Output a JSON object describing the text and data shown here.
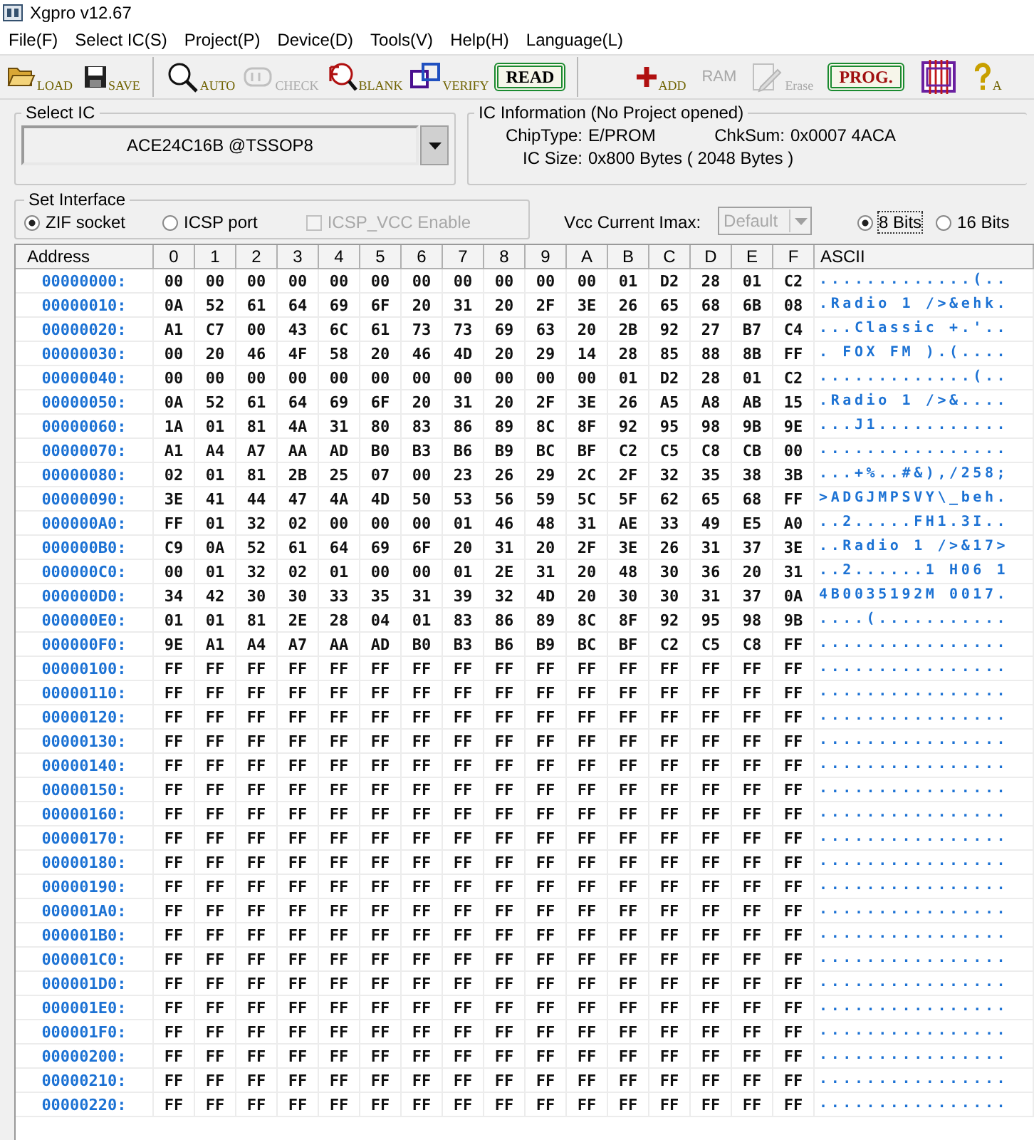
{
  "window": {
    "title": "Xgpro v12.67"
  },
  "menu": [
    "File(F)",
    "Select IC(S)",
    "Project(P)",
    "Device(D)",
    "Tools(V)",
    "Help(H)",
    "Language(L)"
  ],
  "toolbar": {
    "groups": [
      {
        "buttons": [
          {
            "label": "LOAD",
            "kind": "plain",
            "disabled": false
          },
          {
            "label": "SAVE",
            "kind": "plain",
            "disabled": false
          }
        ]
      },
      {
        "buttons": [
          {
            "label": "AUTO",
            "kind": "plain",
            "disabled": false
          },
          {
            "label": "CHECK",
            "kind": "plain",
            "disabled": true
          },
          {
            "label": "BLANK",
            "kind": "plain",
            "disabled": false
          },
          {
            "label": "VERIFY",
            "kind": "plain",
            "disabled": false
          },
          {
            "label": "READ",
            "kind": "boxed",
            "disabled": false
          }
        ]
      },
      {
        "buttons": [
          {
            "label": "ADD",
            "kind": "plain",
            "disabled": false
          },
          {
            "label": "RAM",
            "kind": "text",
            "disabled": true
          },
          {
            "label": "Erase",
            "kind": "plain",
            "disabled": true
          },
          {
            "label": "PROG.",
            "kind": "boxed",
            "disabled": false
          },
          {
            "kind": "icon",
            "disabled": false
          },
          {
            "label": "A",
            "kind": "plain",
            "disabled": false
          }
        ]
      }
    ]
  },
  "select_ic": {
    "title": "Select IC",
    "value": "ACE24C16B @TSSOP8"
  },
  "ic_info": {
    "title": "IC Information (No Project opened)",
    "chip_type": {
      "label": "ChipType:",
      "value": "E/PROM"
    },
    "checksum": {
      "label": "ChkSum:",
      "value": "0x0007 4ACA"
    },
    "ic_size": {
      "label": "IC Size:",
      "value": "0x800 Bytes ( 2048 Bytes )"
    }
  },
  "interface": {
    "title": "Set Interface",
    "options": [
      {
        "label": "ZIF socket",
        "selected": true
      },
      {
        "label": "ICSP port",
        "selected": false
      }
    ],
    "icsp_vcc": {
      "label": "ICSP_VCC Enable",
      "checked": false,
      "disabled": true
    }
  },
  "vcc": {
    "label": "Vcc Current Imax:",
    "value": "Default",
    "disabled": true
  },
  "bits": [
    {
      "label": "8 Bits",
      "selected": true
    },
    {
      "label": "16 Bits",
      "selected": false
    }
  ],
  "table": {
    "columns": [
      "Address",
      "0",
      "1",
      "2",
      "3",
      "4",
      "5",
      "6",
      "7",
      "8",
      "9",
      "A",
      "B",
      "C",
      "D",
      "E",
      "F",
      "ASCII"
    ],
    "rows": [
      {
        "address": "00000000:",
        "bytes": [
          "00",
          "00",
          "00",
          "00",
          "00",
          "00",
          "00",
          "00",
          "00",
          "00",
          "00",
          "01",
          "D2",
          "28",
          "01",
          "C2"
        ],
        "ascii": ".............(.."
      },
      {
        "address": "00000010:",
        "bytes": [
          "0A",
          "52",
          "61",
          "64",
          "69",
          "6F",
          "20",
          "31",
          "20",
          "2F",
          "3E",
          "26",
          "65",
          "68",
          "6B",
          "08"
        ],
        "ascii": ".Radio 1 />&ehk."
      },
      {
        "address": "00000020:",
        "bytes": [
          "A1",
          "C7",
          "00",
          "43",
          "6C",
          "61",
          "73",
          "73",
          "69",
          "63",
          "20",
          "2B",
          "92",
          "27",
          "B7",
          "C4"
        ],
        "ascii": "...Classic +.'.."
      },
      {
        "address": "00000030:",
        "bytes": [
          "00",
          "20",
          "46",
          "4F",
          "58",
          "20",
          "46",
          "4D",
          "20",
          "29",
          "14",
          "28",
          "85",
          "88",
          "8B",
          "FF"
        ],
        "ascii": ". FOX FM ).(...."
      },
      {
        "address": "00000040:",
        "bytes": [
          "00",
          "00",
          "00",
          "00",
          "00",
          "00",
          "00",
          "00",
          "00",
          "00",
          "00",
          "01",
          "D2",
          "28",
          "01",
          "C2"
        ],
        "ascii": ".............(.."
      },
      {
        "address": "00000050:",
        "bytes": [
          "0A",
          "52",
          "61",
          "64",
          "69",
          "6F",
          "20",
          "31",
          "20",
          "2F",
          "3E",
          "26",
          "A5",
          "A8",
          "AB",
          "15"
        ],
        "ascii": ".Radio 1 />&...."
      },
      {
        "address": "00000060:",
        "bytes": [
          "1A",
          "01",
          "81",
          "4A",
          "31",
          "80",
          "83",
          "86",
          "89",
          "8C",
          "8F",
          "92",
          "95",
          "98",
          "9B",
          "9E"
        ],
        "ascii": "...J1..........."
      },
      {
        "address": "00000070:",
        "bytes": [
          "A1",
          "A4",
          "A7",
          "AA",
          "AD",
          "B0",
          "B3",
          "B6",
          "B9",
          "BC",
          "BF",
          "C2",
          "C5",
          "C8",
          "CB",
          "00"
        ],
        "ascii": "................"
      },
      {
        "address": "00000080:",
        "bytes": [
          "02",
          "01",
          "81",
          "2B",
          "25",
          "07",
          "00",
          "23",
          "26",
          "29",
          "2C",
          "2F",
          "32",
          "35",
          "38",
          "3B"
        ],
        "ascii": "...+%..#&),/258;"
      },
      {
        "address": "00000090:",
        "bytes": [
          "3E",
          "41",
          "44",
          "47",
          "4A",
          "4D",
          "50",
          "53",
          "56",
          "59",
          "5C",
          "5F",
          "62",
          "65",
          "68",
          "FF"
        ],
        "ascii": ">ADGJMPSVY\\_beh."
      },
      {
        "address": "000000A0:",
        "bytes": [
          "FF",
          "01",
          "32",
          "02",
          "00",
          "00",
          "00",
          "01",
          "46",
          "48",
          "31",
          "AE",
          "33",
          "49",
          "E5",
          "A0"
        ],
        "ascii": "..2.....FH1.3I.."
      },
      {
        "address": "000000B0:",
        "bytes": [
          "C9",
          "0A",
          "52",
          "61",
          "64",
          "69",
          "6F",
          "20",
          "31",
          "20",
          "2F",
          "3E",
          "26",
          "31",
          "37",
          "3E"
        ],
        "ascii": "..Radio 1 />&17>"
      },
      {
        "address": "000000C0:",
        "bytes": [
          "00",
          "01",
          "32",
          "02",
          "01",
          "00",
          "00",
          "01",
          "2E",
          "31",
          "20",
          "48",
          "30",
          "36",
          "20",
          "31"
        ],
        "ascii": "..2......1 H06 1"
      },
      {
        "address": "000000D0:",
        "bytes": [
          "34",
          "42",
          "30",
          "30",
          "33",
          "35",
          "31",
          "39",
          "32",
          "4D",
          "20",
          "30",
          "30",
          "31",
          "37",
          "0A"
        ],
        "ascii": "4B0035192M 0017."
      },
      {
        "address": "000000E0:",
        "bytes": [
          "01",
          "01",
          "81",
          "2E",
          "28",
          "04",
          "01",
          "83",
          "86",
          "89",
          "8C",
          "8F",
          "92",
          "95",
          "98",
          "9B"
        ],
        "ascii": "....(..........."
      },
      {
        "address": "000000F0:",
        "bytes": [
          "9E",
          "A1",
          "A4",
          "A7",
          "AA",
          "AD",
          "B0",
          "B3",
          "B6",
          "B9",
          "BC",
          "BF",
          "C2",
          "C5",
          "C8",
          "FF"
        ],
        "ascii": "................"
      },
      {
        "address": "00000100:",
        "bytes": [
          "FF",
          "FF",
          "FF",
          "FF",
          "FF",
          "FF",
          "FF",
          "FF",
          "FF",
          "FF",
          "FF",
          "FF",
          "FF",
          "FF",
          "FF",
          "FF"
        ],
        "ascii": "................"
      },
      {
        "address": "00000110:",
        "bytes": [
          "FF",
          "FF",
          "FF",
          "FF",
          "FF",
          "FF",
          "FF",
          "FF",
          "FF",
          "FF",
          "FF",
          "FF",
          "FF",
          "FF",
          "FF",
          "FF"
        ],
        "ascii": "................"
      },
      {
        "address": "00000120:",
        "bytes": [
          "FF",
          "FF",
          "FF",
          "FF",
          "FF",
          "FF",
          "FF",
          "FF",
          "FF",
          "FF",
          "FF",
          "FF",
          "FF",
          "FF",
          "FF",
          "FF"
        ],
        "ascii": "................"
      },
      {
        "address": "00000130:",
        "bytes": [
          "FF",
          "FF",
          "FF",
          "FF",
          "FF",
          "FF",
          "FF",
          "FF",
          "FF",
          "FF",
          "FF",
          "FF",
          "FF",
          "FF",
          "FF",
          "FF"
        ],
        "ascii": "................"
      },
      {
        "address": "00000140:",
        "bytes": [
          "FF",
          "FF",
          "FF",
          "FF",
          "FF",
          "FF",
          "FF",
          "FF",
          "FF",
          "FF",
          "FF",
          "FF",
          "FF",
          "FF",
          "FF",
          "FF"
        ],
        "ascii": "................"
      },
      {
        "address": "00000150:",
        "bytes": [
          "FF",
          "FF",
          "FF",
          "FF",
          "FF",
          "FF",
          "FF",
          "FF",
          "FF",
          "FF",
          "FF",
          "FF",
          "FF",
          "FF",
          "FF",
          "FF"
        ],
        "ascii": "................"
      },
      {
        "address": "00000160:",
        "bytes": [
          "FF",
          "FF",
          "FF",
          "FF",
          "FF",
          "FF",
          "FF",
          "FF",
          "FF",
          "FF",
          "FF",
          "FF",
          "FF",
          "FF",
          "FF",
          "FF"
        ],
        "ascii": "................"
      },
      {
        "address": "00000170:",
        "bytes": [
          "FF",
          "FF",
          "FF",
          "FF",
          "FF",
          "FF",
          "FF",
          "FF",
          "FF",
          "FF",
          "FF",
          "FF",
          "FF",
          "FF",
          "FF",
          "FF"
        ],
        "ascii": "................"
      },
      {
        "address": "00000180:",
        "bytes": [
          "FF",
          "FF",
          "FF",
          "FF",
          "FF",
          "FF",
          "FF",
          "FF",
          "FF",
          "FF",
          "FF",
          "FF",
          "FF",
          "FF",
          "FF",
          "FF"
        ],
        "ascii": "................"
      },
      {
        "address": "00000190:",
        "bytes": [
          "FF",
          "FF",
          "FF",
          "FF",
          "FF",
          "FF",
          "FF",
          "FF",
          "FF",
          "FF",
          "FF",
          "FF",
          "FF",
          "FF",
          "FF",
          "FF"
        ],
        "ascii": "................"
      },
      {
        "address": "000001A0:",
        "bytes": [
          "FF",
          "FF",
          "FF",
          "FF",
          "FF",
          "FF",
          "FF",
          "FF",
          "FF",
          "FF",
          "FF",
          "FF",
          "FF",
          "FF",
          "FF",
          "FF"
        ],
        "ascii": "................"
      },
      {
        "address": "000001B0:",
        "bytes": [
          "FF",
          "FF",
          "FF",
          "FF",
          "FF",
          "FF",
          "FF",
          "FF",
          "FF",
          "FF",
          "FF",
          "FF",
          "FF",
          "FF",
          "FF",
          "FF"
        ],
        "ascii": "................"
      },
      {
        "address": "000001C0:",
        "bytes": [
          "FF",
          "FF",
          "FF",
          "FF",
          "FF",
          "FF",
          "FF",
          "FF",
          "FF",
          "FF",
          "FF",
          "FF",
          "FF",
          "FF",
          "FF",
          "FF"
        ],
        "ascii": "................"
      },
      {
        "address": "000001D0:",
        "bytes": [
          "FF",
          "FF",
          "FF",
          "FF",
          "FF",
          "FF",
          "FF",
          "FF",
          "FF",
          "FF",
          "FF",
          "FF",
          "FF",
          "FF",
          "FF",
          "FF"
        ],
        "ascii": "................"
      },
      {
        "address": "000001E0:",
        "bytes": [
          "FF",
          "FF",
          "FF",
          "FF",
          "FF",
          "FF",
          "FF",
          "FF",
          "FF",
          "FF",
          "FF",
          "FF",
          "FF",
          "FF",
          "FF",
          "FF"
        ],
        "ascii": "................"
      },
      {
        "address": "000001F0:",
        "bytes": [
          "FF",
          "FF",
          "FF",
          "FF",
          "FF",
          "FF",
          "FF",
          "FF",
          "FF",
          "FF",
          "FF",
          "FF",
          "FF",
          "FF",
          "FF",
          "FF"
        ],
        "ascii": "................"
      },
      {
        "address": "00000200:",
        "bytes": [
          "FF",
          "FF",
          "FF",
          "FF",
          "FF",
          "FF",
          "FF",
          "FF",
          "FF",
          "FF",
          "FF",
          "FF",
          "FF",
          "FF",
          "FF",
          "FF"
        ],
        "ascii": "................"
      },
      {
        "address": "00000210:",
        "bytes": [
          "FF",
          "FF",
          "FF",
          "FF",
          "FF",
          "FF",
          "FF",
          "FF",
          "FF",
          "FF",
          "FF",
          "FF",
          "FF",
          "FF",
          "FF",
          "FF"
        ],
        "ascii": "................"
      },
      {
        "address": "00000220:",
        "bytes": [
          "FF",
          "FF",
          "FF",
          "FF",
          "FF",
          "FF",
          "FF",
          "FF",
          "FF",
          "FF",
          "FF",
          "FF",
          "FF",
          "FF",
          "FF",
          "FF"
        ],
        "ascii": "................"
      }
    ]
  }
}
